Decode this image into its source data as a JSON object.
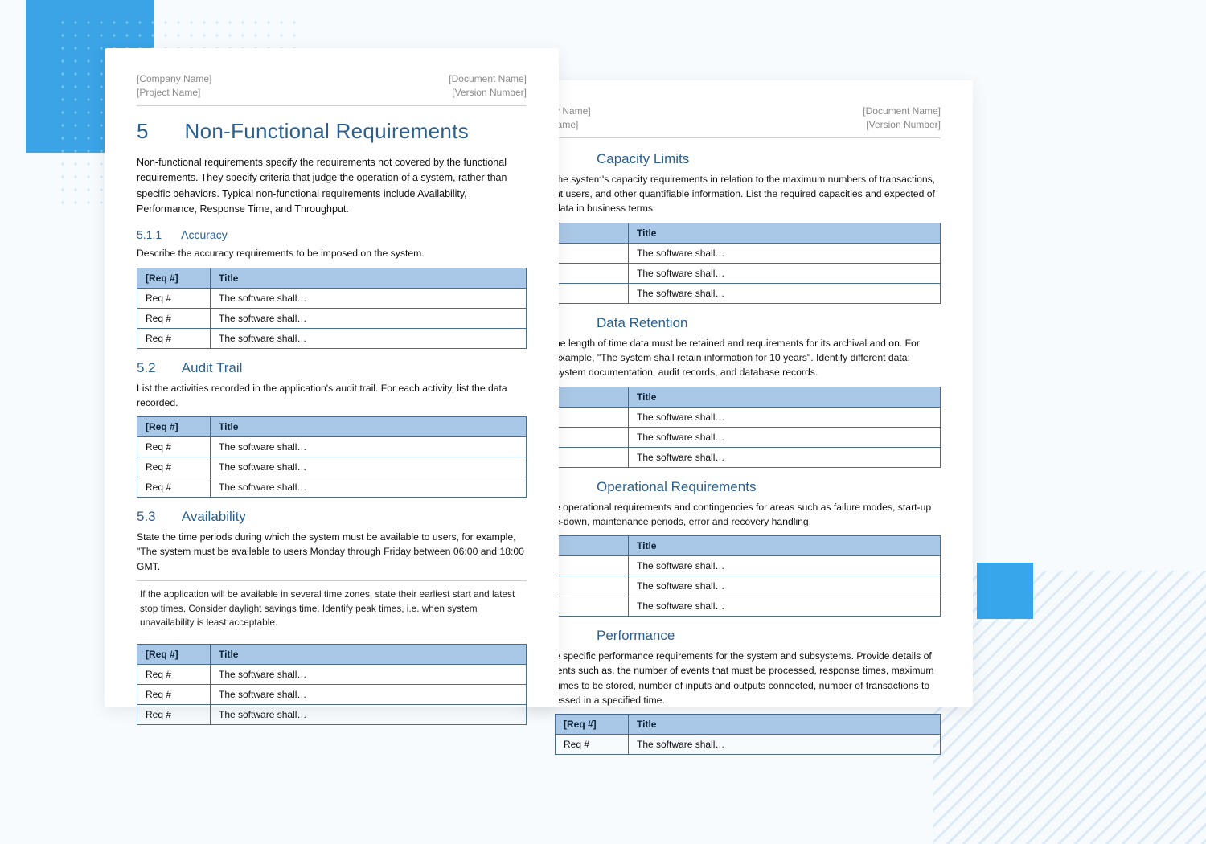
{
  "header": {
    "company": "[Company Name]",
    "project": "[Project Name]",
    "document": "[Document Name]",
    "version": "[Version Number]",
    "company2": "y Name]",
    "project2": "lame]"
  },
  "page1": {
    "title_num": "5",
    "title": "Non-Functional Requirements",
    "intro": "Non-functional requirements specify the requirements not covered by the functional requirements. They specify criteria that judge the operation of a system, rather than specific behaviors. Typical non-functional requirements include Availability, Performance, Response Time, and Throughput.",
    "s511_num": "5.1.1",
    "s511_title": "Accuracy",
    "s511_desc": "Describe the accuracy requirements to be imposed on the system.",
    "s52_num": "5.2",
    "s52_title": "Audit Trail",
    "s52_desc": "List the activities recorded in the application's audit trail. For each activity, list the data recorded.",
    "s53_num": "5.3",
    "s53_title": "Availability",
    "s53_desc": "State the time periods during which the system must be available to users, for example, \"The system must be available to users Monday through Friday between 06:00 and 18:00 GMT.",
    "s53_note": "If the application will be available in several time zones, state their earliest start and latest stop times. Consider daylight savings time. Identify peak times, i.e. when system unavailability is least acceptable."
  },
  "page2": {
    "capacity_title": "Capacity Limits",
    "capacity_desc": "the system's capacity requirements in relation to the maximum numbers of transactions, nt users, and other quantifiable information. List the required capacities and expected of data in business terms.",
    "retention_title": "Data Retention",
    "retention_desc": "he length of time data must be retained and requirements for its archival and on. For example, \"The system shall retain information for 10 years\". Identify different data: system documentation, audit records, and database records.",
    "ops_title": "Operational Requirements",
    "ops_desc": "e operational requirements and contingencies for areas such as failure modes, start-up e-down, maintenance periods, error and recovery handling.",
    "perf_title": "Performance",
    "perf_desc": "e specific performance requirements for the system and subsystems. Provide details of ients such as, the number of events that must be processed, response times, maximum umes to be stored, number of inputs and outputs connected, number of transactions to essed in a specified time."
  },
  "table": {
    "col_req": "[Req #]",
    "col_title": "Title",
    "cell_req": "Req #",
    "cell_title": "The software shall…"
  }
}
